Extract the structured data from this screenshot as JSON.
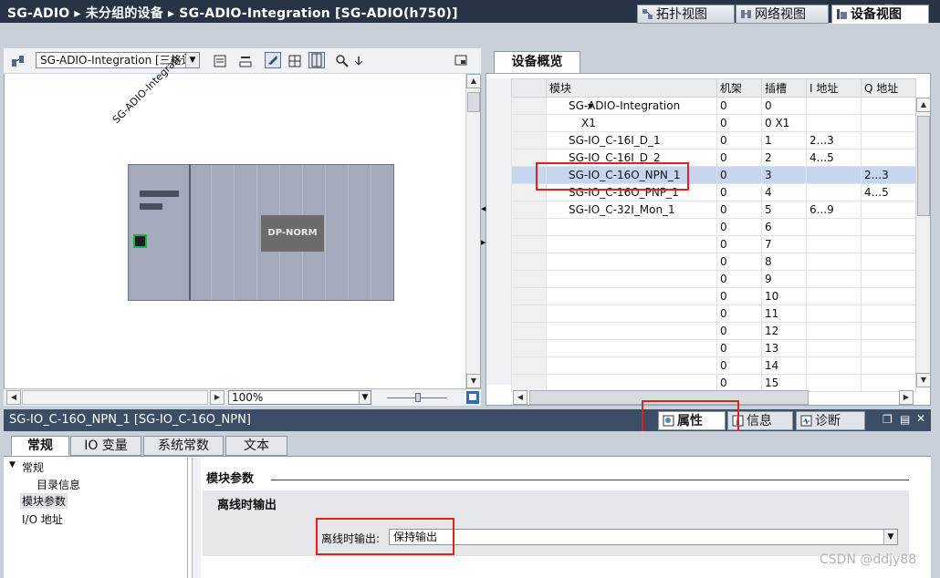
{
  "window": {
    "title": "SG-ADIO  ▸  未分组的设备  ▸  SG-ADIO-Integration [SG-ADIO(h750)]"
  },
  "view_tabs": [
    {
      "label": "拓扑视图"
    },
    {
      "label": "网络视图"
    },
    {
      "label": "设备视图"
    }
  ],
  "editor": {
    "device_select": "SG-ADIO-Integration [三格远程",
    "zoom": "100%",
    "device_label": "SG-ADIO-Integrati...",
    "module_label": "DP-NORM"
  },
  "overview": {
    "tab_label": "设备概览",
    "columns": [
      "模块",
      "机架",
      "插槽",
      "I 地址",
      "Q 地址"
    ],
    "rows": [
      {
        "module": "SG-ADIO-Integration",
        "rack": "0",
        "slot": "0",
        "i": "",
        "q": ""
      },
      {
        "module": "X1",
        "rack": "0",
        "slot": "0 X1",
        "i": "",
        "q": ""
      },
      {
        "module": "SG-IO_C-16I_D_1",
        "rack": "0",
        "slot": "1",
        "i": "2...3",
        "q": ""
      },
      {
        "module": "SG-IO_C-16I_D_2",
        "rack": "0",
        "slot": "2",
        "i": "4...5",
        "q": ""
      },
      {
        "module": "SG-IO_C-16O_NPN_1",
        "rack": "0",
        "slot": "3",
        "i": "",
        "q": "2...3"
      },
      {
        "module": "SG-IO_C-16O_PNP_1",
        "rack": "0",
        "slot": "4",
        "i": "",
        "q": "4...5"
      },
      {
        "module": "SG-IO_C-32I_Mon_1",
        "rack": "0",
        "slot": "5",
        "i": "6...9",
        "q": ""
      },
      {
        "module": "",
        "rack": "0",
        "slot": "6",
        "i": "",
        "q": ""
      },
      {
        "module": "",
        "rack": "0",
        "slot": "7",
        "i": "",
        "q": ""
      },
      {
        "module": "",
        "rack": "0",
        "slot": "8",
        "i": "",
        "q": ""
      },
      {
        "module": "",
        "rack": "0",
        "slot": "9",
        "i": "",
        "q": ""
      },
      {
        "module": "",
        "rack": "0",
        "slot": "10",
        "i": "",
        "q": ""
      },
      {
        "module": "",
        "rack": "0",
        "slot": "11",
        "i": "",
        "q": ""
      },
      {
        "module": "",
        "rack": "0",
        "slot": "12",
        "i": "",
        "q": ""
      },
      {
        "module": "",
        "rack": "0",
        "slot": "13",
        "i": "",
        "q": ""
      },
      {
        "module": "",
        "rack": "0",
        "slot": "14",
        "i": "",
        "q": ""
      },
      {
        "module": "",
        "rack": "0",
        "slot": "15",
        "i": "",
        "q": ""
      }
    ]
  },
  "inspector": {
    "title": "SG-IO_C-16O_NPN_1 [SG-IO_C-16O_NPN]",
    "panel_tabs": [
      {
        "label": "属性"
      },
      {
        "label": "信息"
      },
      {
        "label": "诊断"
      }
    ],
    "prop_tabs": [
      {
        "label": "常规"
      },
      {
        "label": "IO 变量"
      },
      {
        "label": "系统常数"
      },
      {
        "label": "文本"
      }
    ],
    "nav": [
      "常规",
      "目录信息",
      "模块参数",
      "I/O 地址"
    ],
    "section_title": "模块参数",
    "group_title": "离线时输出",
    "field_label": "离线时输出:",
    "field_value": "保持输出"
  },
  "watermark": "CSDN @ddjy88"
}
